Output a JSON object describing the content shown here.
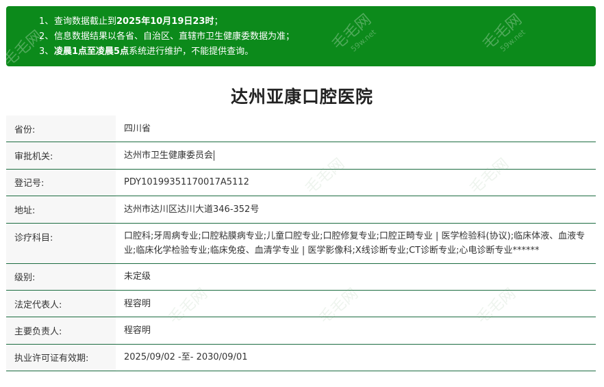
{
  "notice": {
    "items": [
      {
        "num": "1、",
        "text_a": "查询数据截止到",
        "bold": "2025年10月19日23时",
        "text_b": "；"
      },
      {
        "num": "2、",
        "text_a": "信息数据结果以各省、自治区、直辖市卫生健康委数据为准；",
        "bold": "",
        "text_b": ""
      },
      {
        "num": "3、",
        "text_a": "",
        "bold": "凌晨1点至凌晨5点",
        "text_b": "系统进行维护，不能提供查询。"
      }
    ],
    "watermark": "毛毛网",
    "watermark_sub": "59w.net"
  },
  "page_title": "达州亚康口腔医院",
  "rows": [
    {
      "label": "省份:",
      "value": "四川省"
    },
    {
      "label": "审批机关:",
      "value": "达州市卫生健康委员会"
    },
    {
      "label": "登记号:",
      "value": "PDY10199351170017A5112"
    },
    {
      "label": "地址:",
      "value": "达州市达川区达川大道346-352号"
    },
    {
      "label": "诊疗科目:",
      "value": "口腔科;牙周病专业;口腔粘膜病专业;儿童口腔专业;口腔修复专业;口腔正畸专业 | 医学检验科(协议);临床体液、血液专业;临床化学检验专业;临床免疫、血清学专业 | 医学影像科;X线诊断专业;CT诊断专业;心电诊断专业******"
    },
    {
      "label": "级别:",
      "value": "未定级"
    },
    {
      "label": "法定代表人:",
      "value": "程容明"
    },
    {
      "label": "主要负责人:",
      "value": "程容明"
    },
    {
      "label": "执业许可证有效期:",
      "value": "2025/09/02 -至- 2030/09/01"
    }
  ]
}
